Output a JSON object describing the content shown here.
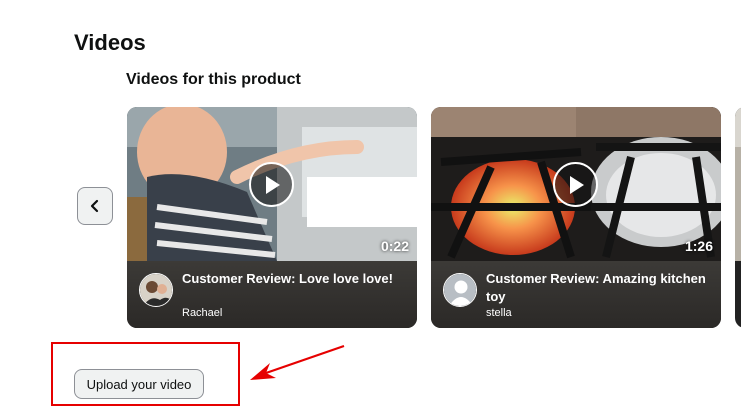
{
  "section": {
    "title": "Videos",
    "subtitle": "Videos for this product"
  },
  "carousel": {
    "prev_icon": "chevron-left-icon",
    "videos": [
      {
        "title": "Customer Review: Love love love!",
        "reviewer": "Rachael",
        "duration": "0:22",
        "play_icon": "play-icon"
      },
      {
        "title": "Customer Review: Amazing kitchen toy",
        "reviewer": "stella",
        "duration": "1:26",
        "play_icon": "play-icon"
      }
    ]
  },
  "upload": {
    "label": "Upload your video"
  },
  "colors": {
    "annotation_red": "#e60000",
    "button_bg": "#f0f2f2",
    "card_info_bg": "#3c3a37"
  }
}
